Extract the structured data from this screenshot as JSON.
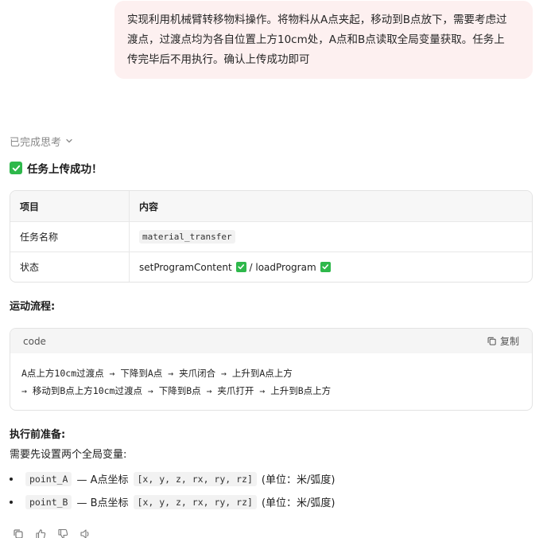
{
  "user_message": {
    "line1": "实现利用机械臂转移物料操作。将物料从A点夹起，移动到B点放下，需要考虑过",
    "line2": "渡点，过渡点均为各自位置上方10cm处，A点和B点读取全局变量获取。任务上",
    "line3": "传完毕后不用执行。确认上传成功即可"
  },
  "thinking": {
    "label": "已完成思考"
  },
  "success": {
    "label": "任务上传成功！"
  },
  "table": {
    "headers": [
      "项目",
      "内容"
    ],
    "rows": [
      {
        "key": "任务名称",
        "value": "material_transfer"
      },
      {
        "key": "状态",
        "value_a": "setProgramContent",
        "separator": " / ",
        "value_b": "loadProgram"
      }
    ]
  },
  "flow": {
    "title": "运动流程:",
    "code_lang": "code",
    "copy_label": "复制",
    "line1": "A点上方10cm过渡点 → 下降到A点 → 夹爪闭合 → 上升到A点上方",
    "line2": "→ 移动到B点上方10cm过渡点 → 下降到B点 → 夹爪打开 → 上升到B点上方"
  },
  "prep": {
    "title": "执行前准备:",
    "intro": "需要先设置两个全局变量:",
    "items": [
      {
        "var": "point_A",
        "desc": "— A点坐标",
        "coords": "[x, y, z, rx, ry, rz]",
        "unit": "(单位：米/弧度)"
      },
      {
        "var": "point_B",
        "desc": "— B点坐标",
        "coords": "[x, y, z, rx, ry, rz]",
        "unit": "(单位：米/弧度)"
      }
    ]
  },
  "colors": {
    "accent_success": "#2eb84b",
    "bubble_bg": "#fdf0f0"
  }
}
